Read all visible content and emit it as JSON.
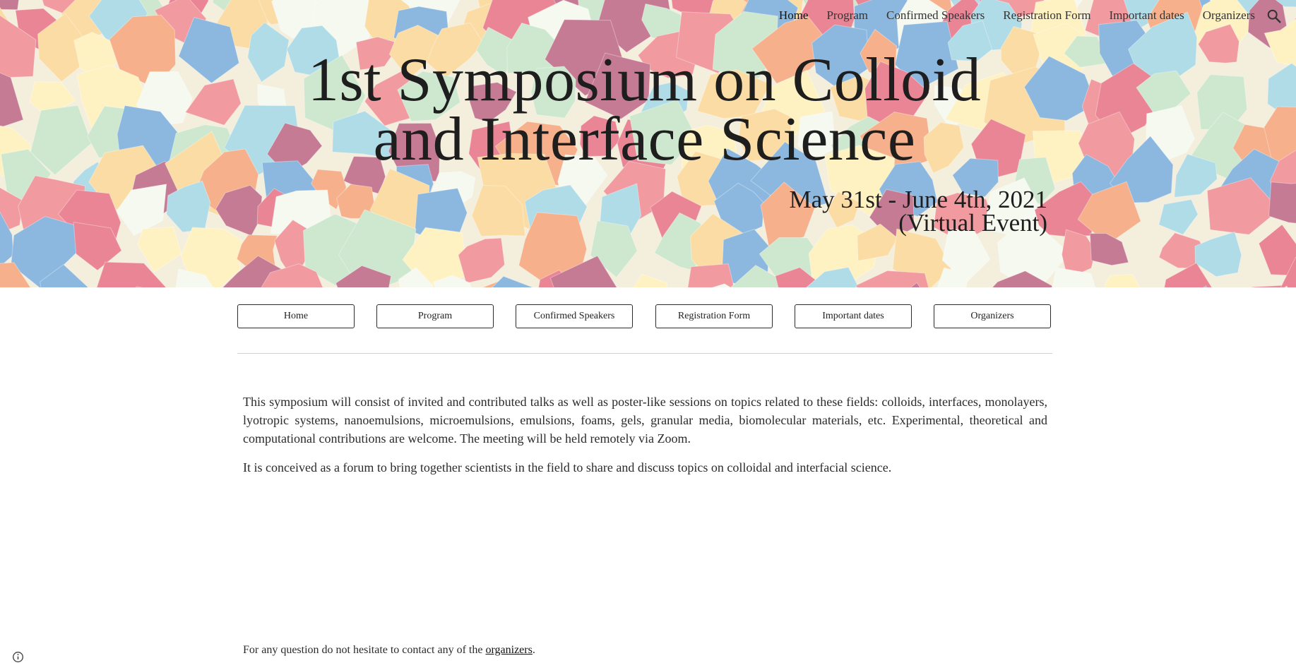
{
  "topnav": {
    "items": [
      {
        "label": "Home",
        "active": true
      },
      {
        "label": "Program"
      },
      {
        "label": "Confirmed Speakers"
      },
      {
        "label": "Registration Form"
      },
      {
        "label": "Important dates"
      },
      {
        "label": "Organizers"
      }
    ],
    "search_icon": "search-icon"
  },
  "header": {
    "title_line1": "1st Symposium on Colloid",
    "title_line2": "and Interface Science",
    "date_line": "May 31st - June 4th, 2021",
    "event_line": "(Virtual Event)"
  },
  "buttons": [
    {
      "label": "Home"
    },
    {
      "label": "Program"
    },
    {
      "label": "Confirmed Speakers"
    },
    {
      "label": "Registration Form"
    },
    {
      "label": "Important dates"
    },
    {
      "label": "Organizers"
    }
  ],
  "content": {
    "paragraph1": "This symposium will consist of invited and contributed talks as well as poster-like sessions on topics related to these fields: colloids, interfaces, monolayers, lyotropic systems, nanoemulsions, microemulsions, emulsions, foams, gels, granular media, biomolecular materials, etc. Experimental, theoretical and computational contributions are welcome. The meeting will be held remotely via Zoom.",
    "paragraph2": "It is conceived as a forum to bring together scientists in the field to share and discuss topics on colloidal and interfacial science.",
    "contact_text": "For any question do not hesitate to contact any of the ",
    "contact_link": "organizers",
    "contact_end": "."
  },
  "colors": {
    "mosaic": [
      "#e8788a",
      "#f5a97f",
      "#fbd99a",
      "#fef1bd",
      "#a8d8e6",
      "#7fb0dc",
      "#c8e6c9",
      "#f4f9ef",
      "#f08f96",
      "#c06c8a"
    ]
  }
}
